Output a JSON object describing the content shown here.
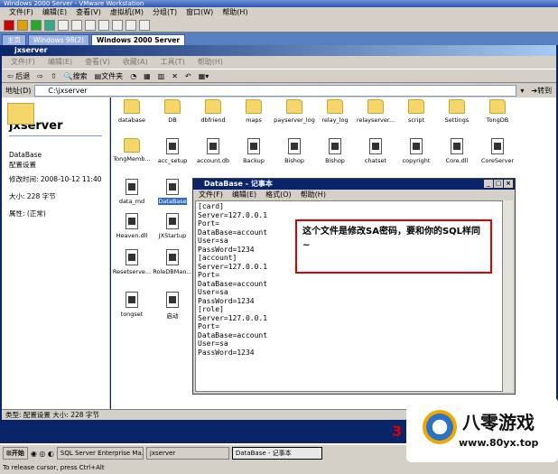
{
  "host": {
    "title": "Windows 2000 Server - VMware Workstation",
    "menu": [
      "文件(F)",
      "编辑(E)",
      "查看(V)",
      "虚拟机(M)",
      "分组(T)",
      "窗口(W)",
      "帮助(H)"
    ],
    "tabs": [
      "主页",
      "Windows 98(2)",
      "Windows 2000 Server"
    ],
    "status_text": "To release cursor, press Ctrl+Alt"
  },
  "explorer": {
    "title": "jxserver",
    "menu": [
      "文件(F)",
      "编辑(E)",
      "查看(V)",
      "收藏(A)",
      "工具(T)",
      "帮助(H)"
    ],
    "toolbar": {
      "back": "后退",
      "search": "搜索",
      "folders": "文件夹"
    },
    "address_label": "地址(D)",
    "address_value": "C:\\jxserver",
    "go_label": "转到",
    "left_panel": {
      "folder_name": "jxserver",
      "file_name": "DataBase",
      "file_type": "配置设置",
      "modified": "修改时间: 2008-10-12 11:40",
      "size": "大小: 228 字节",
      "attributes": "属性: (正常)"
    },
    "items": [
      {
        "label": "database",
        "type": "folder"
      },
      {
        "label": "DB",
        "type": "folder"
      },
      {
        "label": "dbfriend",
        "type": "folder"
      },
      {
        "label": "maps",
        "type": "folder"
      },
      {
        "label": "payserver_log",
        "type": "folder"
      },
      {
        "label": "relay_log",
        "type": "folder"
      },
      {
        "label": "relayserver...",
        "type": "folder"
      },
      {
        "label": "script",
        "type": "folder"
      },
      {
        "label": "Settings",
        "type": "folder"
      },
      {
        "label": "TongDB",
        "type": "folder"
      },
      {
        "label": "TongMemb...",
        "type": "folder"
      },
      {
        "label": "acc_setup",
        "type": "file"
      },
      {
        "label": "account.db",
        "type": "file"
      },
      {
        "label": "Backup",
        "type": "file"
      },
      {
        "label": "Bishop",
        "type": "file"
      },
      {
        "label": "Bishop",
        "type": "file"
      },
      {
        "label": "chatset",
        "type": "file"
      },
      {
        "label": "copyright",
        "type": "file"
      },
      {
        "label": "Core.dll",
        "type": "file"
      },
      {
        "label": "CoreServer",
        "type": "file"
      },
      {
        "label": "data_md",
        "type": "file"
      },
      {
        "label": "DataBase",
        "type": "file"
      },
      {
        "label": "Heaven.dll",
        "type": "file"
      },
      {
        "label": "JXStartup",
        "type": "file"
      },
      {
        "label": "Resetserve...",
        "type": "file"
      },
      {
        "label": "RoleDBMan...",
        "type": "file"
      },
      {
        "label": "tongset",
        "type": "file"
      },
      {
        "label": "启动",
        "type": "file"
      }
    ],
    "status": "类型: 配置设置 大小: 228 字节"
  },
  "notepad": {
    "title": "DataBase - 记事本",
    "menu": [
      "文件(F)",
      "编辑(E)",
      "格式(O)",
      "帮助(H)"
    ],
    "content": "[card]\nServer=127.0.0.1\nPort=\nDataBase=account\nUser=sa\nPassWord=1234\n[account]\nServer=127.0.0.1\nPort=\nDataBase=account\nUser=sa\nPassWord=1234\n[role]\nServer=127.0.0.1\nPort=\nDataBase=account\nUser=sa\nPassWord=1234"
  },
  "annotation": "这个文件是修改SA密码，要和你的SQL样同~",
  "taskbar": {
    "start": "开始",
    "tasks": [
      "SQL Server Enterprise Ma...",
      "jxserver",
      "DataBase - 记事本"
    ]
  },
  "watermark": {
    "name": "八零游戏",
    "url": "www.80yx.top",
    "digit": "3"
  }
}
